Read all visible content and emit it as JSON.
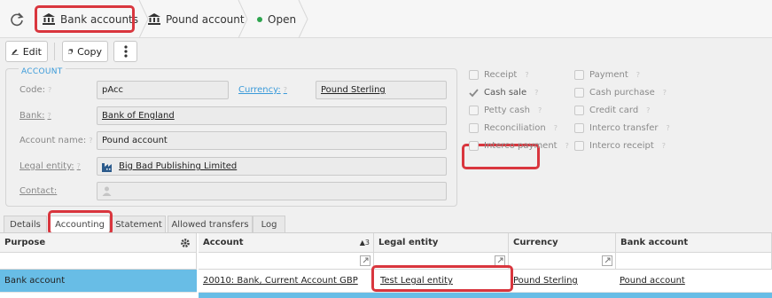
{
  "breadcrumb": {
    "refresh_icon": "refresh-icon",
    "items": [
      {
        "label": "Bank accounts",
        "icon": "bank-icon"
      },
      {
        "label": "Pound account",
        "icon": "bank-icon"
      },
      {
        "label": "Open",
        "icon": "status-dot-icon"
      }
    ]
  },
  "toolbar": {
    "edit_label": "Edit",
    "copy_label": "Copy",
    "more_icon": "more-vertical-icon"
  },
  "account": {
    "section_title": "ACCOUNT",
    "code_label": "Code:",
    "code_value": "pAcc",
    "currency_label": "Currency:",
    "currency_value": "Pound Sterling",
    "bank_label": "Bank:",
    "bank_value": "Bank of England",
    "name_label": "Account name:",
    "name_value": "Pound account",
    "legal_entity_label": "Legal entity:",
    "legal_entity_value": "Big Bad Publishing Limited",
    "contact_label": "Contact:",
    "contact_value": "",
    "help_mark": "?"
  },
  "flags": {
    "left": [
      {
        "label": "Receipt",
        "checked": false
      },
      {
        "label": "Cash sale",
        "checked": true
      },
      {
        "label": "Petty cash",
        "checked": false
      },
      {
        "label": "Reconciliation",
        "checked": false
      },
      {
        "label": "Interco payment",
        "checked": false
      }
    ],
    "right": [
      {
        "label": "Payment",
        "checked": false
      },
      {
        "label": "Cash purchase",
        "checked": false
      },
      {
        "label": "Credit card",
        "checked": false
      },
      {
        "label": "Interco transfer",
        "checked": false
      },
      {
        "label": "Interco receipt",
        "checked": false
      }
    ]
  },
  "tabs": [
    "Details",
    "Accounting",
    "Statement",
    "Allowed transfers",
    "Log"
  ],
  "purpose_grid": {
    "header": "Purpose",
    "rows": [
      "Bank account"
    ]
  },
  "accounting_grid": {
    "headers": [
      "Account",
      "Legal entity",
      "Currency",
      "Bank account"
    ],
    "sort_indicator": "▲3",
    "rows": [
      [
        "20010: Bank, Current Account GBP",
        "Test Legal entity",
        "Pound Sterling",
        "Pound account"
      ]
    ]
  },
  "colors": {
    "highlight": "#d9363e",
    "link": "#3a9ad9",
    "selected_row": "#68bde6",
    "status_open": "#2da44e"
  }
}
